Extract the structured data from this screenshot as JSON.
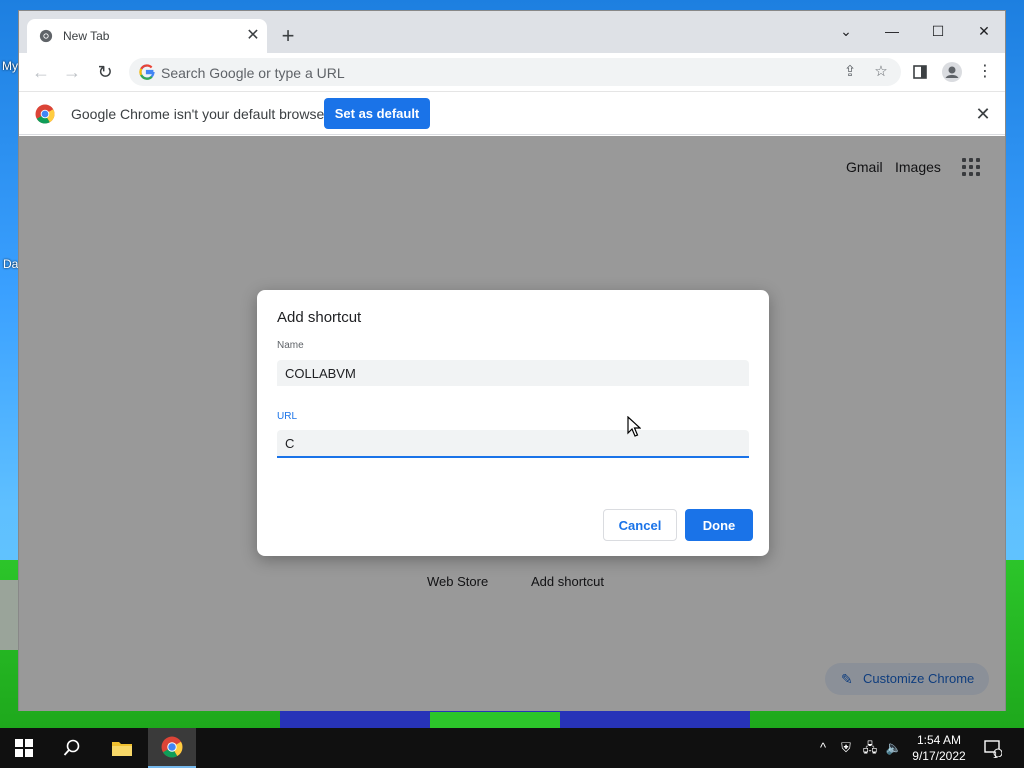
{
  "desktop": {
    "label_top": "My",
    "label_bottom": "Da"
  },
  "browser": {
    "tab": {
      "title": "New Tab",
      "close": "✕"
    },
    "new_tab": "+",
    "window_controls": {
      "dropdown": "⌄",
      "minimize": "—",
      "maximize": "☐",
      "close": "✕"
    },
    "omnibox": {
      "placeholder": "Search Google or type a URL"
    },
    "infobar": {
      "message": "Google Chrome isn't your default browser",
      "button": "Set as default"
    }
  },
  "page": {
    "links": {
      "gmail": "Gmail",
      "images": "Images"
    },
    "shortcuts": [
      "Web Store",
      "Add shortcut"
    ],
    "customize": "Customize Chrome"
  },
  "dialog": {
    "title": "Add shortcut",
    "name_label": "Name",
    "name_value": "COLLABVM",
    "url_label": "URL",
    "url_value": "C",
    "cancel": "Cancel",
    "done": "Done"
  },
  "taskbar": {
    "time": "1:54 AM",
    "date": "9/17/2022",
    "notifications": "1"
  },
  "colors": {
    "accent": "#1a73e8",
    "taskbar": "#101010"
  }
}
